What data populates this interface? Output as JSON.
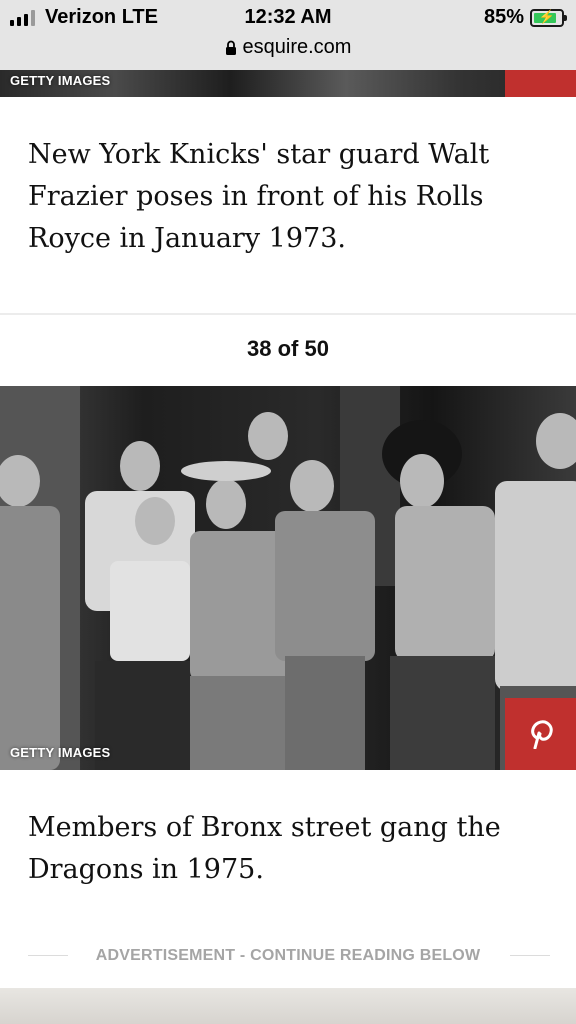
{
  "status_bar": {
    "carrier": "Verizon LTE",
    "time": "12:32 AM",
    "battery": "85%",
    "battery_level": 0.85,
    "url": "esquire.com"
  },
  "slides": {
    "previous": {
      "credit": "GETTY IMAGES",
      "caption": "New York Knicks' star guard Walt Frazier poses in front of his Rolls Royce in January 1973."
    },
    "current": {
      "counter": "38 of 50",
      "credit": "GETTY IMAGES",
      "caption": "Members of Bronx street gang the Dragons in 1975."
    }
  },
  "ad": {
    "label": "ADVERTISEMENT - CONTINUE READING BELOW"
  },
  "colors": {
    "pinterest_red": "#c0302e",
    "battery_green": "#34c759"
  },
  "icons": {
    "signal": "signal-bars-icon",
    "lock": "lock-icon",
    "battery": "battery-charging-icon",
    "pinterest": "pinterest-icon"
  }
}
